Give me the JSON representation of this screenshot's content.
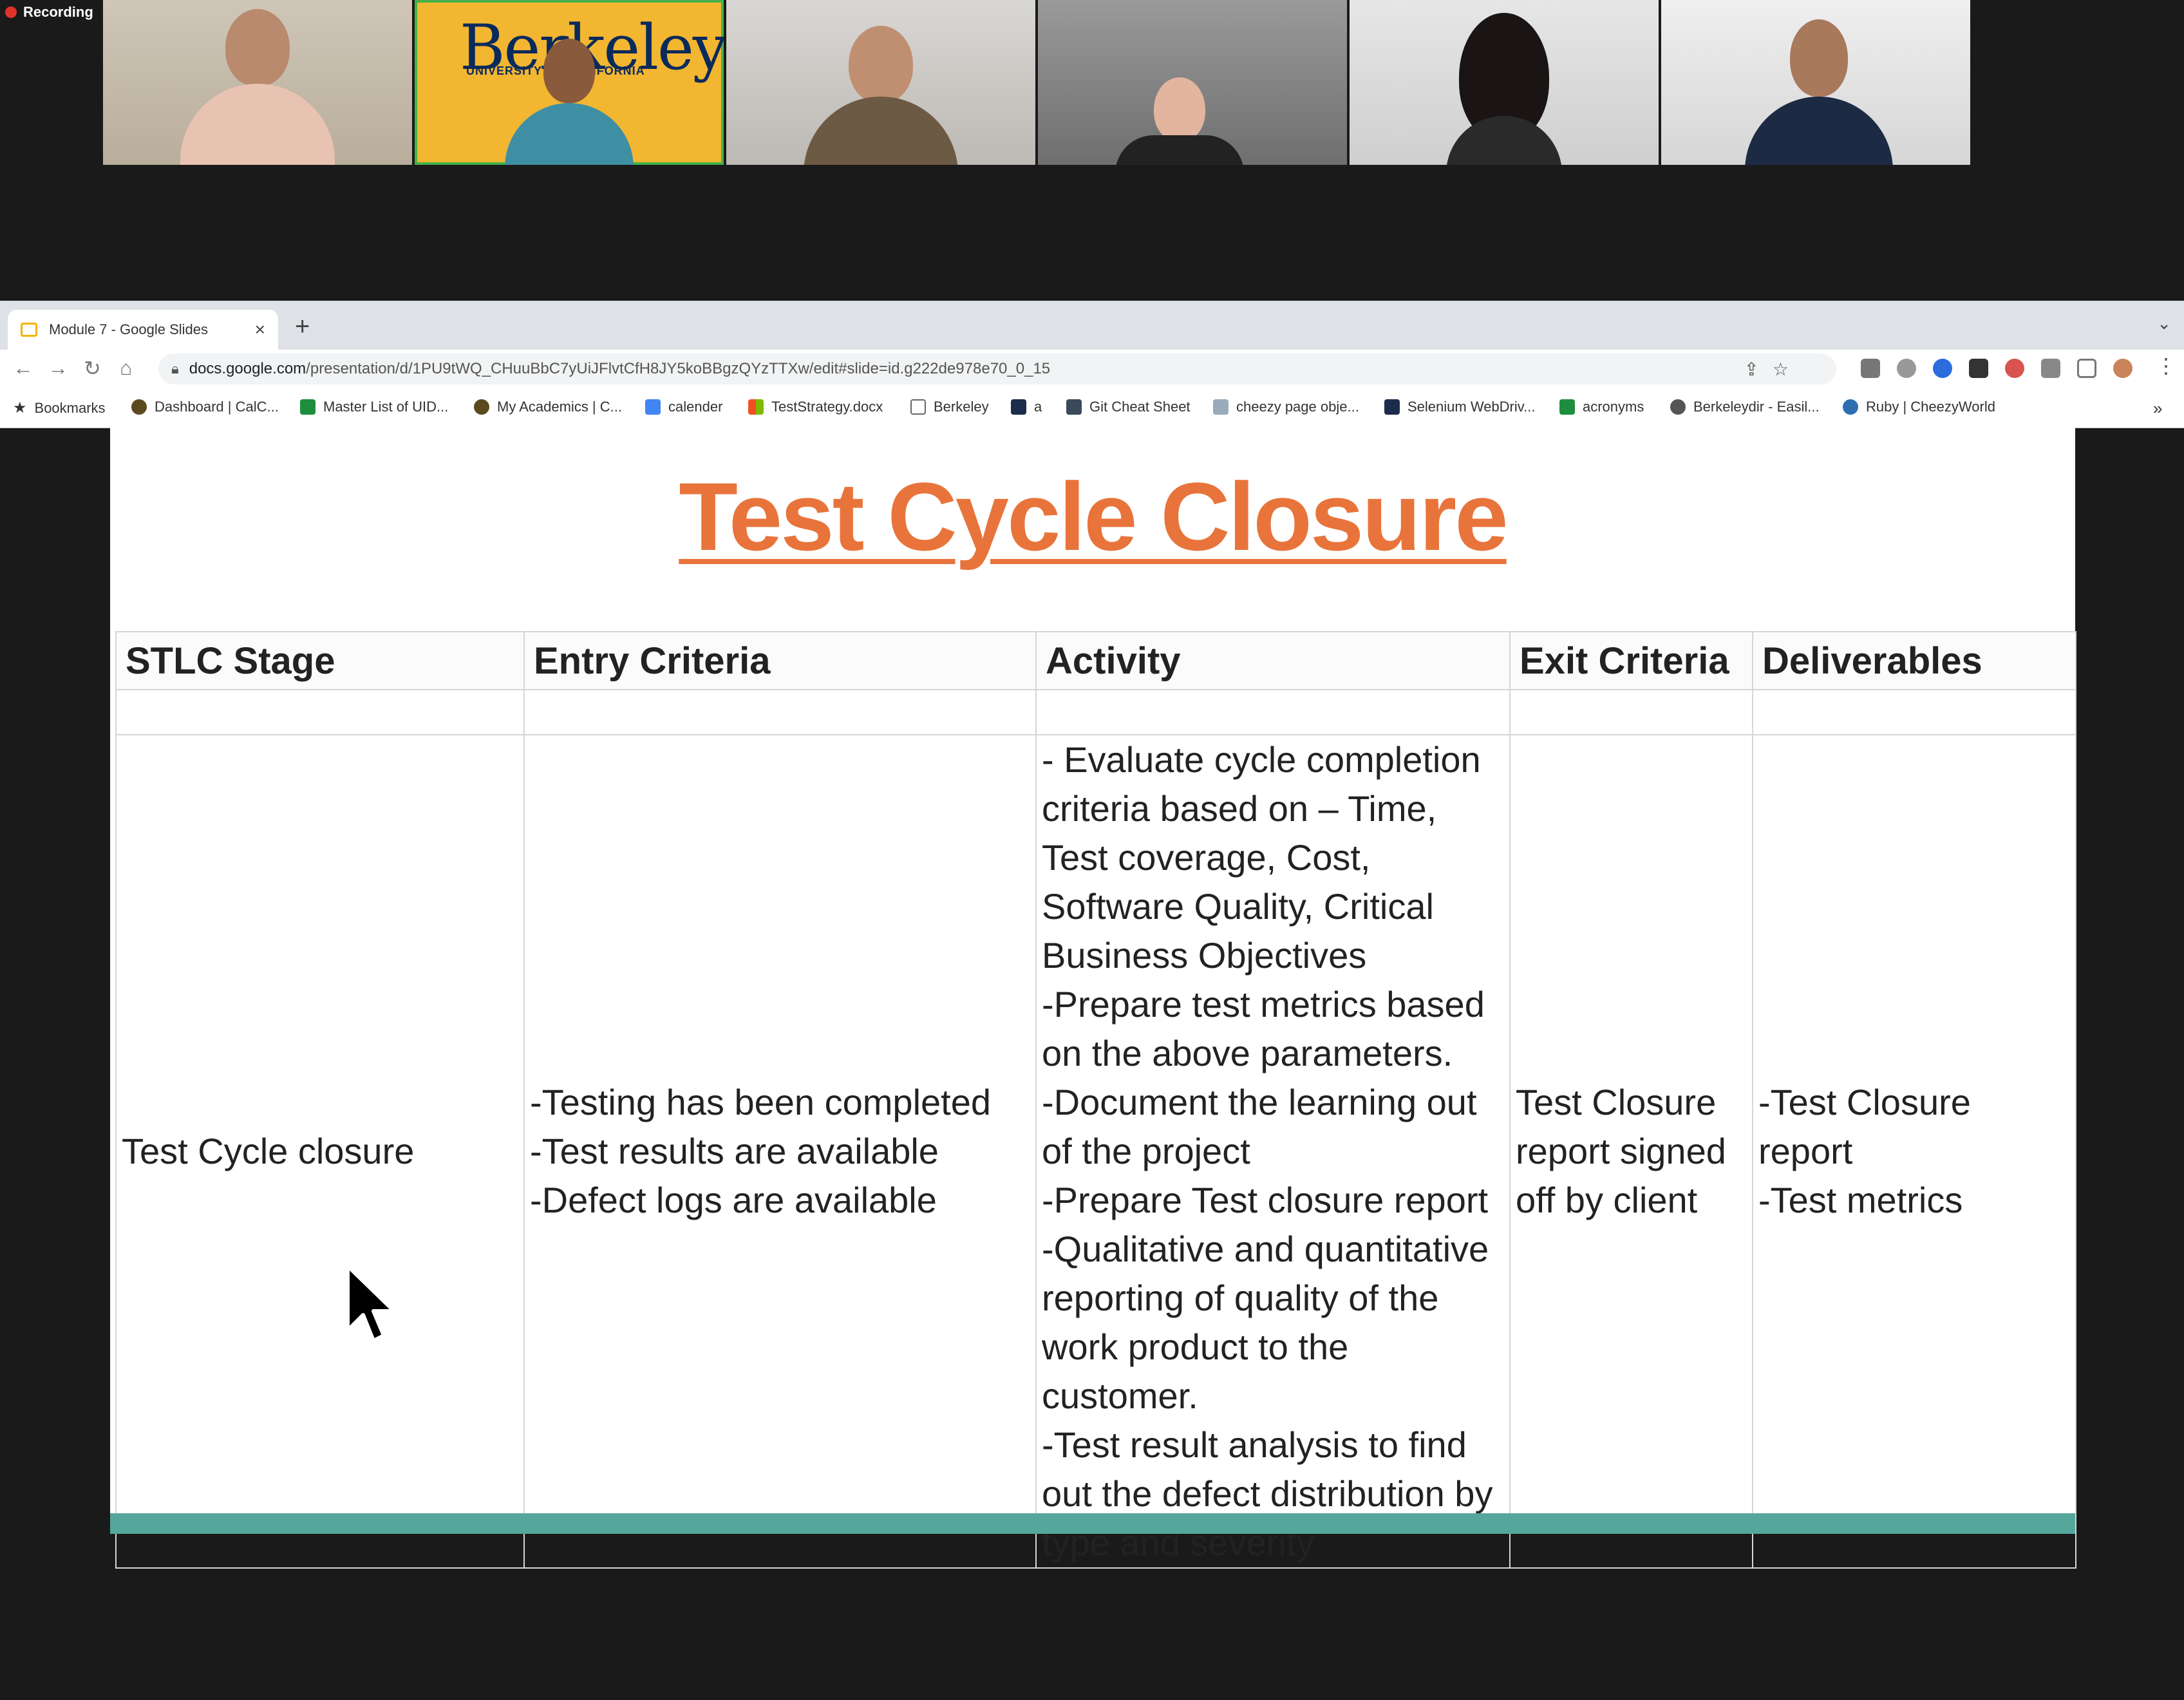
{
  "recording": {
    "label": "Recording"
  },
  "participants": [
    {
      "name": "participant-1"
    },
    {
      "name": "participant-2",
      "logo": "Berkeley",
      "logo_sub": "UNIVERSITY OF CALIFORNIA"
    },
    {
      "name": "participant-3"
    },
    {
      "name": "participant-4"
    },
    {
      "name": "participant-5"
    },
    {
      "name": "participant-6"
    }
  ],
  "browser": {
    "tab_title": "Module 7 - Google Slides",
    "url_host": "docs.google.com",
    "url_path": "/presentation/d/1PU9tWQ_CHuuBbC7yUiJFlvtCfH8JY5koBBgzQYzTTXw/edit#slide=id.g222de978e70_0_15",
    "bookmarks": [
      "Bookmarks",
      "Dashboard | CalC...",
      "Master List of UID...",
      "My Academics | C...",
      "calender",
      "TestStrategy.docx",
      "Berkeley",
      "a",
      "Git Cheat Sheet",
      "cheezy page obje...",
      "Selenium WebDriv...",
      "acronyms",
      "Berkeleydir - Easil...",
      "Ruby | CheezyWorld"
    ]
  },
  "slide": {
    "title": "Test Cycle Closure",
    "headers": [
      "STLC Stage",
      "Entry Criteria",
      "Activity",
      "Exit Criteria",
      "Deliverables"
    ],
    "row": {
      "stage": "Test Cycle closure",
      "entry": "-Testing has been completed\n-Test results are available\n-Defect logs are available",
      "activity": "- Evaluate cycle completion criteria based on – Time, Test coverage, Cost, Software Quality, Critical Business Objectives\n-Prepare test metrics based on the above parameters.\n-Document the learning out of the project\n-Prepare Test closure report\n-Qualitative and quantitative reporting of quality of the work product to the customer.\n-Test result analysis to find out the defect distribution by type and severity",
      "exit": "Test Closure report signed off by client",
      "deliverables": "-Test Closure report\n-Test metrics"
    }
  },
  "colors": {
    "title": "#e8743b",
    "accent_bar": "#55a79b",
    "active_speaker": "#46b04a"
  }
}
